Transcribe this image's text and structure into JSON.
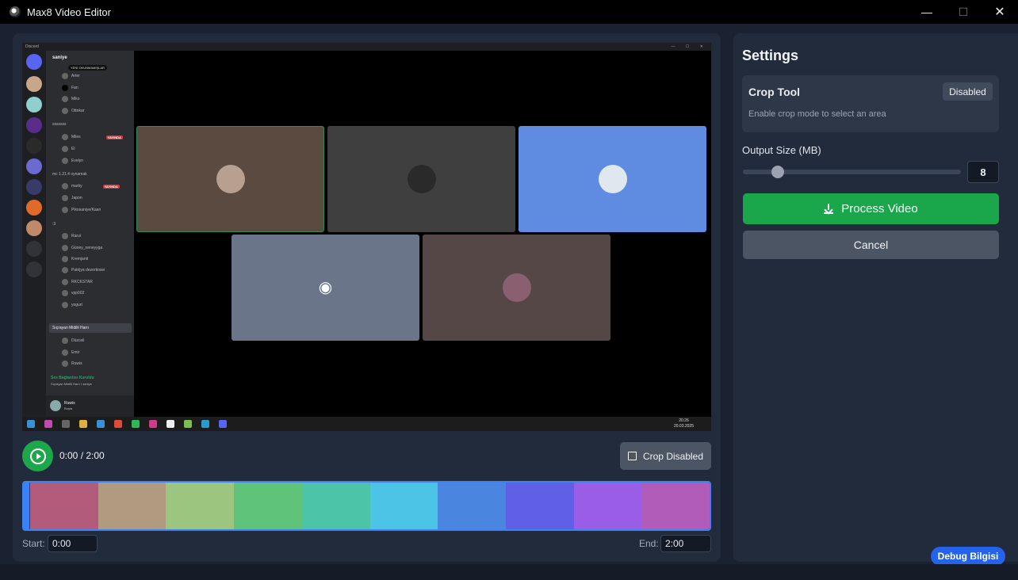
{
  "window": {
    "title": "Max8 Video Editor",
    "minimize": "—",
    "maximize": "☐",
    "close": "✕"
  },
  "video": {
    "discord": {
      "app_name": "Discord",
      "server_name": "saniye",
      "unread_banner": "YENİ OKUNMAMIŞLAR",
      "channels": [
        {
          "type": "user",
          "name": "Arter"
        },
        {
          "type": "user",
          "name": "Fan"
        },
        {
          "type": "user",
          "name": "Miko"
        },
        {
          "type": "user",
          "name": "Ottokar"
        },
        {
          "type": "category",
          "name": "sssssss"
        },
        {
          "type": "user",
          "name": "Miles",
          "badge": "YAYINDA"
        },
        {
          "type": "user",
          "name": "El"
        },
        {
          "type": "user",
          "name": "Evelyn"
        },
        {
          "type": "category",
          "name": "mc 1.21.4 oynamak"
        },
        {
          "type": "user",
          "name": "marky",
          "badge": "YAYINDA"
        },
        {
          "type": "user",
          "name": "Japon"
        },
        {
          "type": "user",
          "name": "Pikosaniye/Kaan"
        },
        {
          "type": "category",
          "name": ":3"
        },
        {
          "type": "user",
          "name": "Rarui"
        },
        {
          "type": "user",
          "name": "Güney_neneyyga"
        },
        {
          "type": "user",
          "name": "Kremjanti"
        },
        {
          "type": "user",
          "name": "Patrijya dezertiosei"
        },
        {
          "type": "user",
          "name": "RKCKSTAR"
        },
        {
          "type": "user",
          "name": "vpp002"
        },
        {
          "type": "user",
          "name": "yogurt"
        },
        {
          "type": "category",
          "name": "Sıçrayan Midilli Harrı"
        },
        {
          "type": "user",
          "name": "Düzceli"
        },
        {
          "type": "user",
          "name": "Emir"
        },
        {
          "type": "user",
          "name": "Ruwis"
        }
      ],
      "voice_status": "Ses Bağlantısı Kuruldu",
      "voice_channel": "Sıçrayan Midilli Harrı / saniye",
      "user_name": "Ruwis",
      "user_status": "Boşta",
      "clock_time": "20:26",
      "clock_date": "20.03.2025"
    }
  },
  "player": {
    "current_time": "0:00",
    "duration": "2:00",
    "time_display": "0:00 / 2:00",
    "crop_button_label": "Crop Disabled"
  },
  "timeline": {
    "segments": [
      "#b25b7a",
      "#b09b80",
      "#9cc680",
      "#5fc47a",
      "#4cc4a8",
      "#4cc4e6",
      "#4a86e0",
      "#6060e6",
      "#9a5ee6",
      "#b05cb8"
    ]
  },
  "trim": {
    "start_label": "Start:",
    "start_value": "0:00",
    "end_label": "End:",
    "end_value": "2:00"
  },
  "settings": {
    "title": "Settings",
    "crop_tool": {
      "title": "Crop Tool",
      "status": "Disabled",
      "description": "Enable crop mode to select an area"
    },
    "output_size": {
      "label": "Output Size (MB)",
      "value": "8",
      "slider_fraction": 0.16
    },
    "process_label": "Process Video",
    "cancel_label": "Cancel"
  },
  "debug_label": "Debug Bilgisi"
}
